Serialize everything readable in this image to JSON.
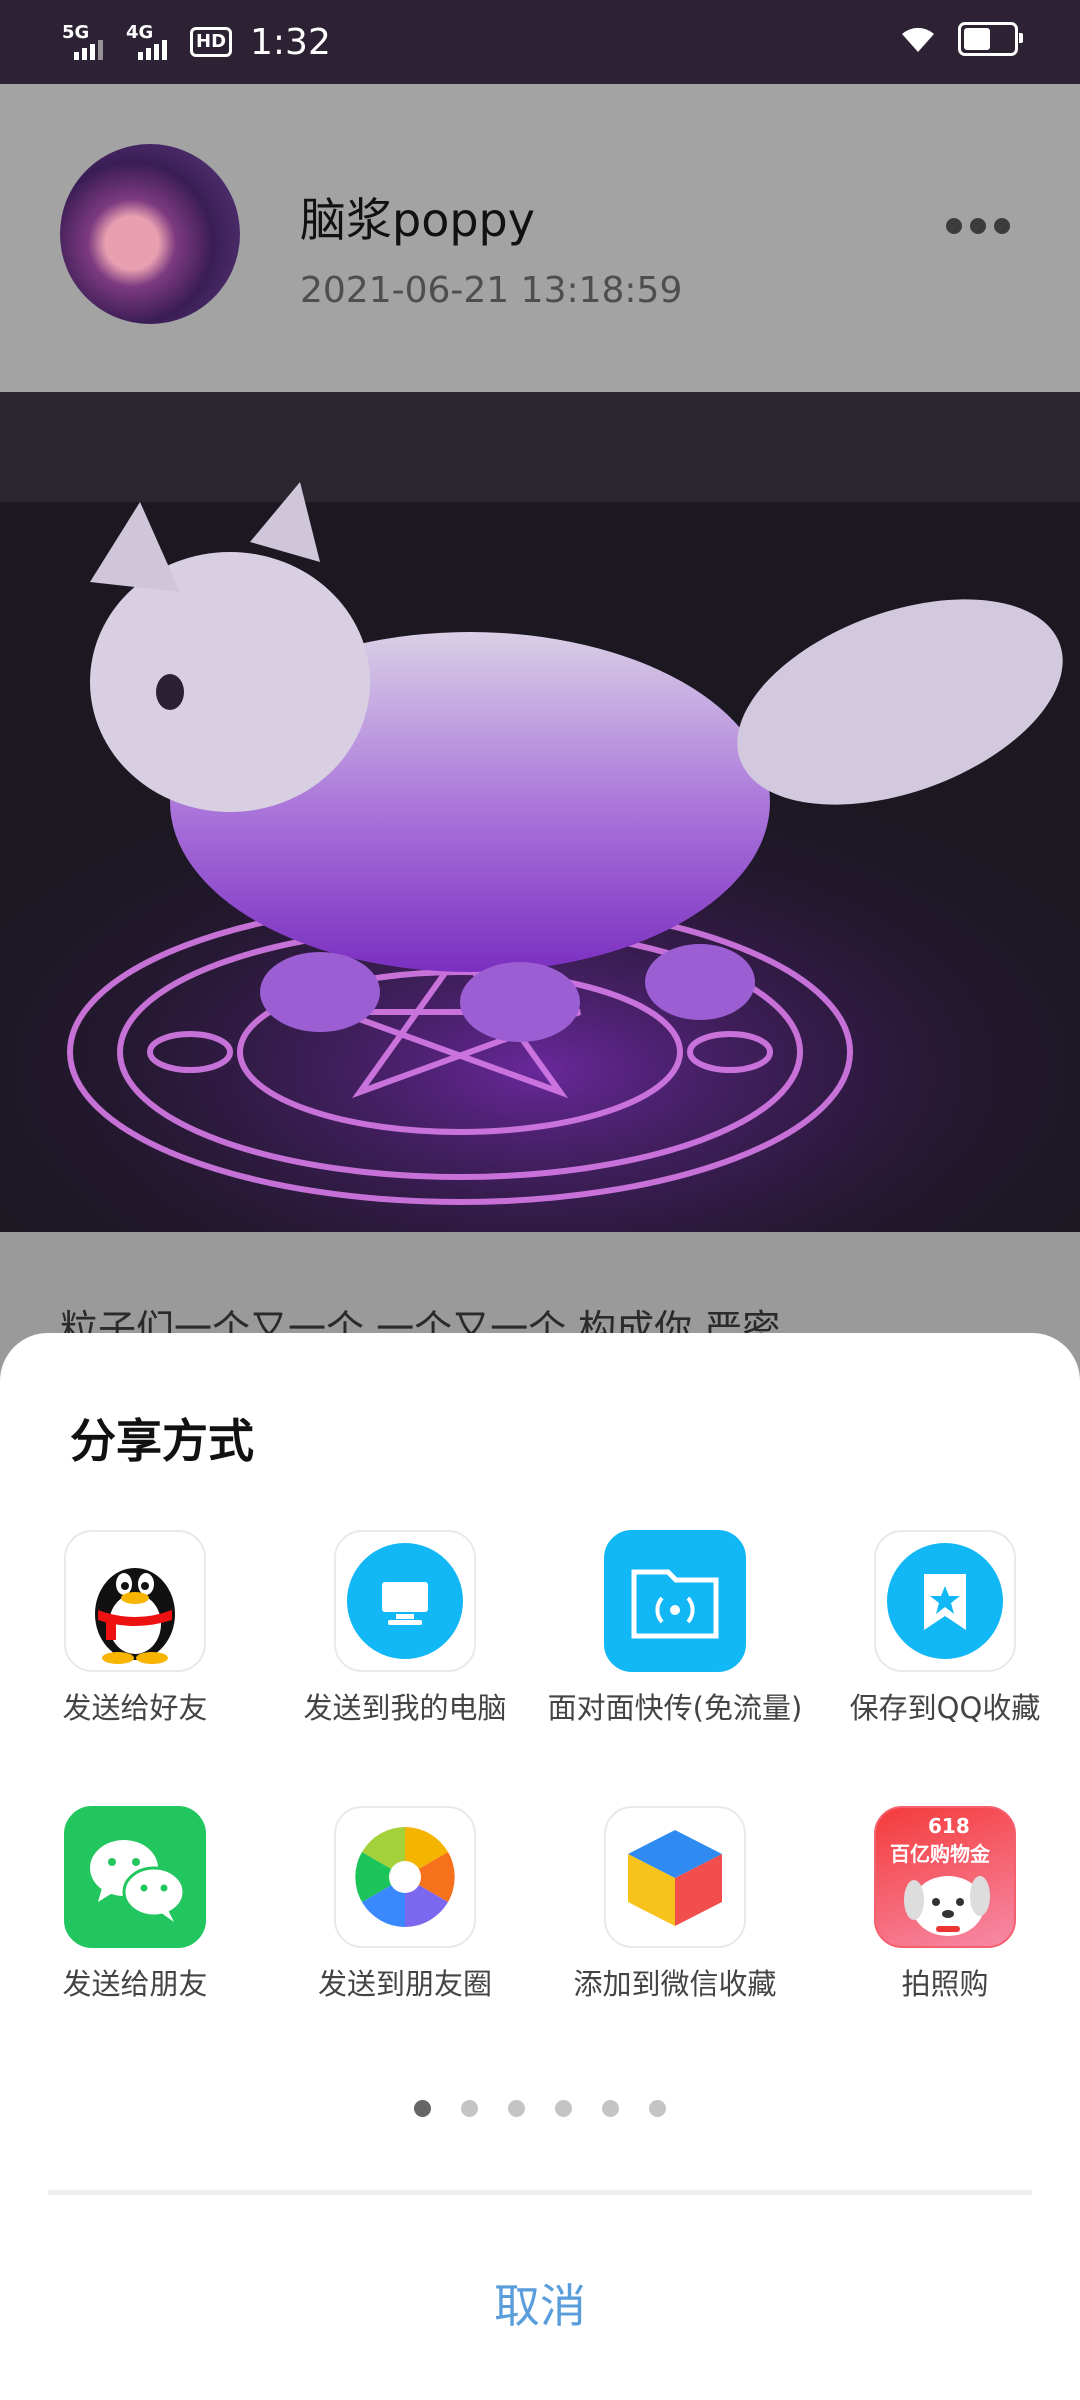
{
  "status_bar": {
    "network1": "5G",
    "network2": "4G",
    "hd": "HD",
    "time": "1:32",
    "battery_level": 0.55
  },
  "post": {
    "username": "脑浆poppy",
    "datetime": "2021-06-21 13:18:59",
    "text": "粒子们一个又一个 一个又一个 构成你 严密"
  },
  "share_sheet": {
    "title": "分享方式",
    "items": [
      {
        "label": "发送给好友",
        "icon": "qq-penguin-icon"
      },
      {
        "label": "发送到我的电脑",
        "icon": "computer-icon"
      },
      {
        "label": "面对面快传(免流量)",
        "icon": "face-to-face-transfer-icon"
      },
      {
        "label": "保存到QQ收藏",
        "icon": "favorite-star-icon"
      },
      {
        "label": "发送给朋友",
        "icon": "wechat-icon"
      },
      {
        "label": "发送到朋友圈",
        "icon": "moments-shutter-icon"
      },
      {
        "label": "添加到微信收藏",
        "icon": "wechat-favorites-cube-icon"
      },
      {
        "label": "拍照购",
        "icon": "jd-dog-icon"
      }
    ],
    "jd_badge_top": "618",
    "jd_badge_bottom": "百亿购物金",
    "page_count": 6,
    "current_page": 1,
    "cancel_label": "取消"
  },
  "colors": {
    "status_bar_bg": "#2c2233",
    "cancel_blue": "#5a9ddb",
    "qq_blue": "#12b7f5",
    "wechat_green": "#1aad19"
  }
}
